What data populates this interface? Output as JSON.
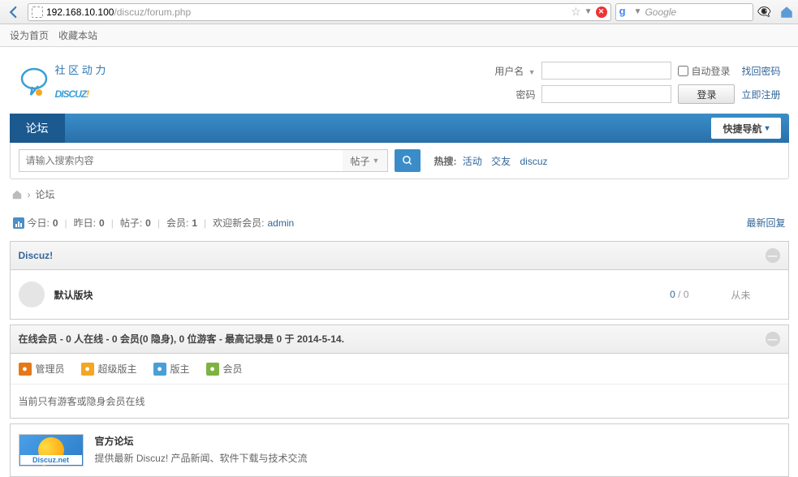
{
  "browser": {
    "url_host": "192.168.10.100",
    "url_path": "/discuz/forum.php",
    "search_placeholder": "Google"
  },
  "toolbar": {
    "set_home": "设为首页",
    "favorite": "收藏本站"
  },
  "logo": {
    "subtitle": "社 区 动 力",
    "main": "DISCUZ",
    "excl": "!"
  },
  "login": {
    "user_label": "用户名",
    "pass_label": "密码",
    "auto_label": "自动登录",
    "find_pwd": "找回密码",
    "register": "立即注册",
    "submit": "登录"
  },
  "nav": {
    "forum": "论坛",
    "quick": "快捷导航"
  },
  "search": {
    "placeholder": "请输入搜索内容",
    "type": "帖子",
    "hot_label": "热搜:",
    "hot_links": [
      "活动",
      "交友",
      "discuz"
    ]
  },
  "breadcrumb": {
    "current": "论坛"
  },
  "stats": {
    "today_l": "今日:",
    "today_v": "0",
    "yest_l": "昨日:",
    "yest_v": "0",
    "posts_l": "帖子:",
    "posts_v": "0",
    "members_l": "会员:",
    "members_v": "1",
    "welcome_l": "欢迎新会员:",
    "welcome_v": "admin",
    "latest": "最新回复"
  },
  "section": {
    "title": "Discuz!",
    "forum_name": "默认版块",
    "count1": "0",
    "count2": "0",
    "never": "从未"
  },
  "online": {
    "header": "在线会员 - 0 人在线 - 0 会员(0 隐身), 0 位游客 - 最高记录是 0 于 2014-5-14.",
    "roles": [
      "管理员",
      "超级版主",
      "版主",
      "会员"
    ],
    "msg": "当前只有游客或隐身会员在线"
  },
  "official": {
    "img_label": "Discuz.net",
    "title": "官方论坛",
    "desc": "提供最新 Discuz! 产品新闻、软件下载与技术交流"
  }
}
